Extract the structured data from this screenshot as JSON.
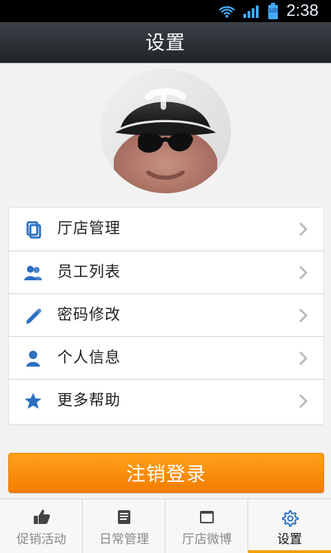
{
  "status_bar": {
    "time": "2:38",
    "battery_level": "100",
    "icons": [
      "wifi-icon",
      "signal-icon",
      "battery-icon"
    ]
  },
  "header": {
    "title": "设置"
  },
  "profile": {
    "avatar": "avatar-photo"
  },
  "menu": {
    "items": [
      {
        "label": "厅店管理",
        "icon": "documents-icon"
      },
      {
        "label": "员工列表",
        "icon": "users-icon"
      },
      {
        "label": "密码修改",
        "icon": "pencil-icon"
      },
      {
        "label": "个人信息",
        "icon": "person-icon"
      },
      {
        "label": "更多帮助",
        "icon": "star-icon"
      }
    ]
  },
  "logout": {
    "label": "注销登录"
  },
  "bottom_nav": {
    "tabs": [
      {
        "label": "促销活动",
        "icon": "thumbs-up-icon"
      },
      {
        "label": "日常管理",
        "icon": "notes-icon"
      },
      {
        "label": "厅店微博",
        "icon": "window-icon"
      },
      {
        "label": "设置",
        "icon": "gear-icon"
      }
    ],
    "active_index": 3
  },
  "colors": {
    "accent": "#f2a000",
    "icon_blue": "#2c6fbf",
    "logout_top": "#ffa21a",
    "logout_bottom": "#f47c00"
  }
}
